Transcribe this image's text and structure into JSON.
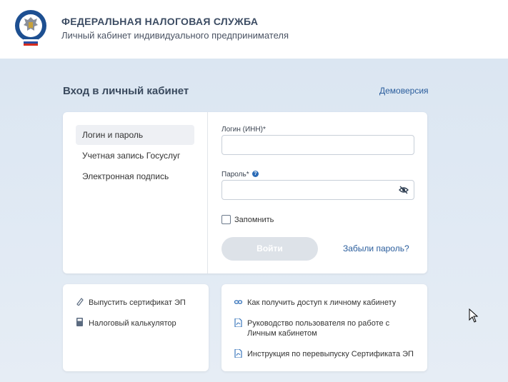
{
  "header": {
    "title": "ФЕДЕРАЛЬНАЯ НАЛОГОВАЯ СЛУЖБА",
    "subtitle": "Личный кабинет индивидуального предпринимателя"
  },
  "page": {
    "title": "Вход в личный кабинет",
    "demo_link": "Демоверсия"
  },
  "login_methods": [
    {
      "label": "Логин и пароль",
      "active": true
    },
    {
      "label": "Учетная запись Госуслуг",
      "active": false
    },
    {
      "label": "Электронная подпись",
      "active": false
    }
  ],
  "form": {
    "login_label": "Логин (ИНН)*",
    "login_value": "",
    "password_label": "Пароль*",
    "password_value": "",
    "help_icon_text": "?",
    "remember_label": "Запомнить",
    "submit_label": "Войти",
    "forgot_link": "Забыли пароль?"
  },
  "links_left": [
    {
      "label": "Выпустить сертификат ЭП",
      "icon": "pen-icon"
    },
    {
      "label": "Налоговый калькулятор",
      "icon": "calculator-icon"
    }
  ],
  "links_right": [
    {
      "label": "Как получить доступ к личному кабинету",
      "icon": "link-icon"
    },
    {
      "label": "Руководство пользователя по работе с Личным кабинетом",
      "icon": "pdf-icon"
    },
    {
      "label": "Инструкция по перевыпуску Сертификата ЭП",
      "icon": "pdf-icon"
    }
  ],
  "colors": {
    "accent": "#2a5d9c",
    "background": "#e6edf5",
    "button_disabled": "#dde2e8"
  }
}
